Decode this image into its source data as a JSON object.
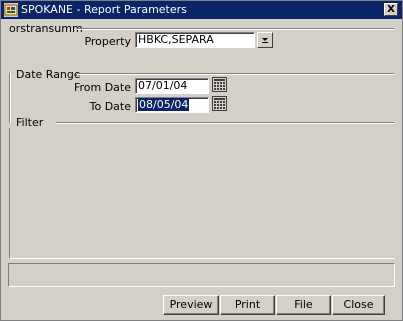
{
  "window": {
    "title": "SPOKANE - Report Parameters",
    "close_glyph": "X",
    "icon": "opera-app-icon"
  },
  "report_name": "orstransumm",
  "property": {
    "label": "Property",
    "value": "HBKC,SEPARA",
    "dropdown_icon": "dropdown-arrow-icon"
  },
  "date_range": {
    "section_label": "Date Range",
    "from_label": "From Date",
    "from_value": "07/01/04",
    "to_label": "To Date",
    "to_value": "08/05/04",
    "calendar_icon": "calendar-icon"
  },
  "filter": {
    "section_label": "Filter"
  },
  "buttons": {
    "preview": "Preview",
    "print": "Print",
    "file": "File",
    "close": "Close"
  },
  "colors": {
    "titlebar": "#0a246a",
    "face": "#d4d0c8",
    "selection": "#0a246a"
  }
}
